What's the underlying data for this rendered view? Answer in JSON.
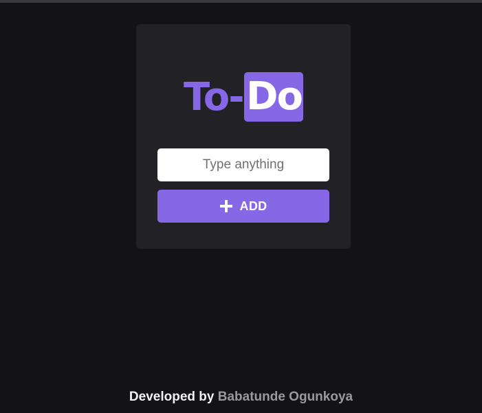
{
  "logo": {
    "part_one": "To-",
    "part_two": "Do"
  },
  "task_input": {
    "value": "",
    "placeholder": "Type anything"
  },
  "add_button": {
    "label": "ADD",
    "icon": "plus-icon"
  },
  "footer": {
    "prefix": "Developed by ",
    "author": "Babatunde Ogunkoya"
  },
  "colors": {
    "background": "#131315",
    "card": "#212126",
    "accent": "#8668e6",
    "input_bg": "#ffffff"
  }
}
